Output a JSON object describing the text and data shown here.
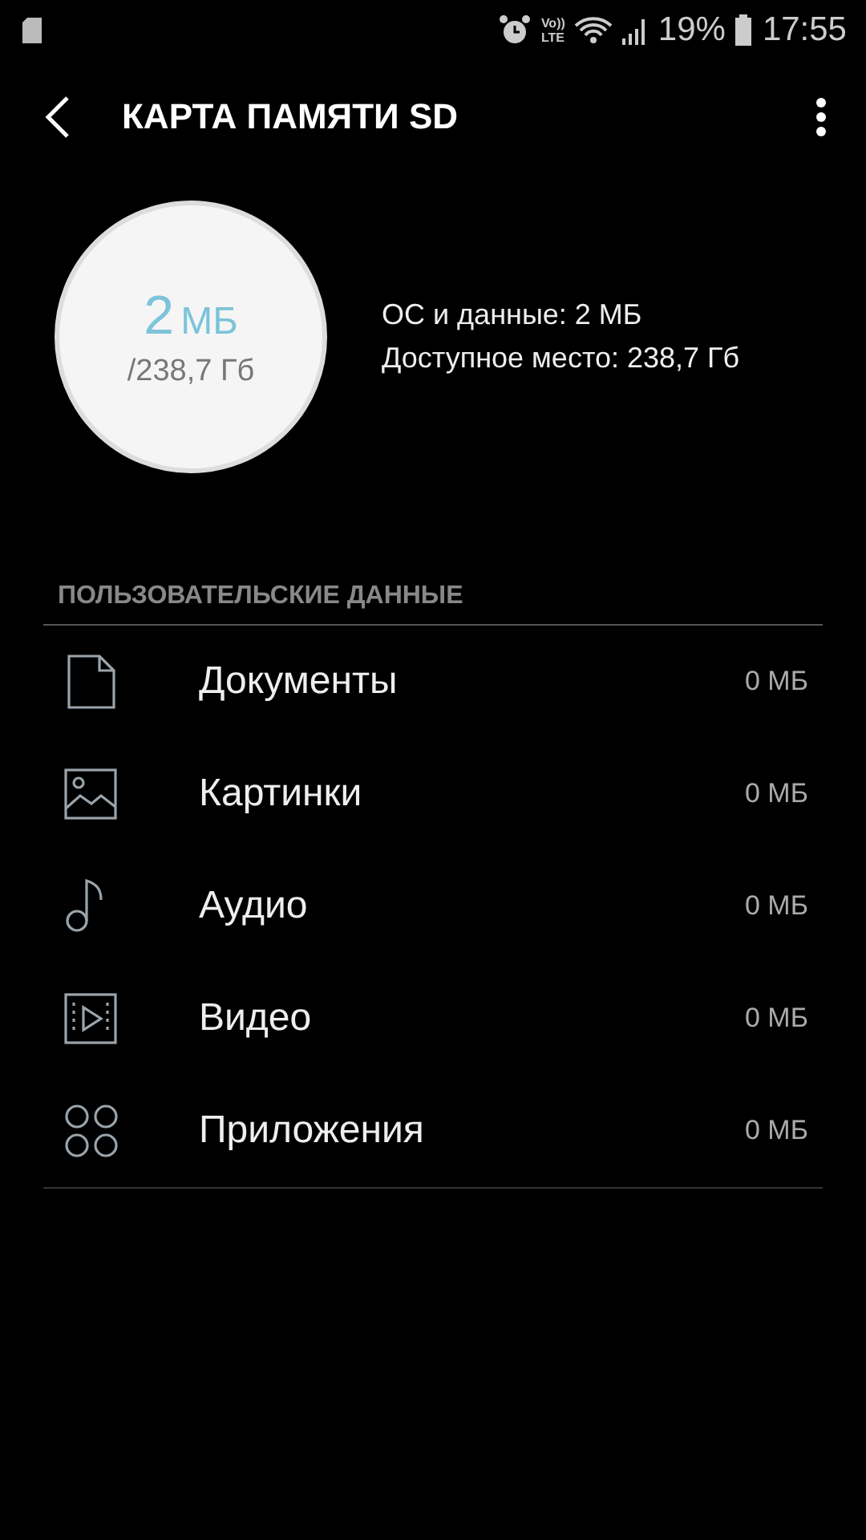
{
  "status_bar": {
    "volte": [
      "Vo))",
      "LTE"
    ],
    "battery": "19%",
    "time": "17:55"
  },
  "toolbar": {
    "title": "КАРТА ПАМЯТИ SD"
  },
  "usage": {
    "used": "2",
    "used_unit": "МБ",
    "total": "/238,7 Гб",
    "lines": [
      "ОС и данные: 2 МБ",
      "Доступное место: 238,7 Гб"
    ]
  },
  "section": {
    "title": "ПОЛЬЗОВАТЕЛЬСКИЕ ДАННЫЕ",
    "items": [
      {
        "kind": "document",
        "label": "Документы",
        "size": "0 МБ"
      },
      {
        "kind": "image",
        "label": "Картинки",
        "size": "0 МБ"
      },
      {
        "kind": "audio",
        "label": "Аудио",
        "size": "0 МБ"
      },
      {
        "kind": "video",
        "label": "Видео",
        "size": "0 МБ"
      },
      {
        "kind": "apps",
        "label": "Приложения",
        "size": "0 МБ"
      }
    ]
  }
}
